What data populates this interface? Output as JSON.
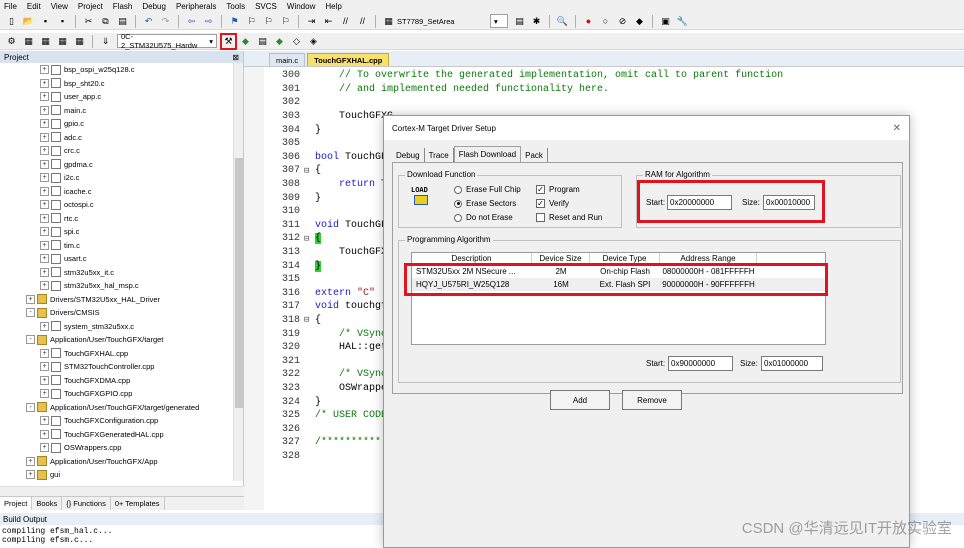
{
  "menubar": [
    "File",
    "Edit",
    "View",
    "Project",
    "Flash",
    "Debug",
    "Peripherals",
    "Tools",
    "SVCS",
    "Window",
    "Help"
  ],
  "toolbar": {
    "target_set_area": "ST7789_SetArea",
    "project_target": "0C-2_STM32U575_Hardw"
  },
  "project_panel": {
    "title": "Project",
    "items": [
      {
        "label": "bsp_ospi_w25q128.c",
        "type": "file",
        "indent": 3
      },
      {
        "label": "bsp_sht20.c",
        "type": "file",
        "indent": 3
      },
      {
        "label": "user_app.c",
        "type": "file",
        "indent": 3
      },
      {
        "label": "main.c",
        "type": "file",
        "indent": 3
      },
      {
        "label": "gpio.c",
        "type": "file",
        "indent": 3
      },
      {
        "label": "adc.c",
        "type": "file",
        "indent": 3
      },
      {
        "label": "crc.c",
        "type": "file",
        "indent": 3
      },
      {
        "label": "gpdma.c",
        "type": "file",
        "indent": 3
      },
      {
        "label": "i2c.c",
        "type": "file",
        "indent": 3
      },
      {
        "label": "icache.c",
        "type": "file",
        "indent": 3
      },
      {
        "label": "octospi.c",
        "type": "file",
        "indent": 3
      },
      {
        "label": "rtc.c",
        "type": "file",
        "indent": 3
      },
      {
        "label": "spi.c",
        "type": "file",
        "indent": 3
      },
      {
        "label": "tim.c",
        "type": "file",
        "indent": 3
      },
      {
        "label": "usart.c",
        "type": "file",
        "indent": 3
      },
      {
        "label": "stm32u5xx_it.c",
        "type": "file",
        "indent": 3
      },
      {
        "label": "stm32u5xx_hal_msp.c",
        "type": "file",
        "indent": 3
      },
      {
        "label": "Drivers/STM32U5xx_HAL_Driver",
        "type": "folder",
        "indent": 2,
        "sign": "+"
      },
      {
        "label": "Drivers/CMSIS",
        "type": "folder",
        "indent": 2,
        "sign": "-"
      },
      {
        "label": "system_stm32u5xx.c",
        "type": "file",
        "indent": 3
      },
      {
        "label": "Application/User/TouchGFX/target",
        "type": "folder",
        "indent": 2,
        "sign": "-"
      },
      {
        "label": "TouchGFXHAL.cpp",
        "type": "file",
        "indent": 3
      },
      {
        "label": "STM32TouchController.cpp",
        "type": "file",
        "indent": 3
      },
      {
        "label": "TouchGFXDMA.cpp",
        "type": "file",
        "indent": 3
      },
      {
        "label": "TouchGFXGPIO.cpp",
        "type": "file",
        "indent": 3
      },
      {
        "label": "Application/User/TouchGFX/target/generated",
        "type": "folder",
        "indent": 2,
        "sign": "-"
      },
      {
        "label": "TouchGFXConfiguration.cpp",
        "type": "file",
        "indent": 3
      },
      {
        "label": "TouchGFXGeneratedHAL.cpp",
        "type": "file",
        "indent": 3
      },
      {
        "label": "OSWrappers.cpp",
        "type": "file",
        "indent": 3
      },
      {
        "label": "Application/User/TouchGFX/App",
        "type": "folder",
        "indent": 2,
        "sign": "+"
      },
      {
        "label": "gui",
        "type": "folder",
        "indent": 2,
        "sign": "+"
      }
    ],
    "bottom_tabs": [
      "Project",
      "Books",
      "{} Functions",
      "0+ Templates"
    ]
  },
  "editor": {
    "tabs": [
      {
        "label": "main.c",
        "active": false
      },
      {
        "label": "TouchGFXHAL.cpp",
        "active": true
      }
    ],
    "lines": [
      {
        "n": "300",
        "fold": "",
        "segs": [
          {
            "t": "    // To overwrite the generated implementation, omit call to parent function",
            "c": "cm"
          }
        ]
      },
      {
        "n": "301",
        "fold": "",
        "segs": [
          {
            "t": "    // and implemented needed functionality here.",
            "c": "cm"
          }
        ]
      },
      {
        "n": "302",
        "fold": "",
        "segs": [
          {
            "t": "",
            "c": ""
          }
        ]
      },
      {
        "n": "303",
        "fold": "",
        "segs": [
          {
            "t": "    TouchGFXG",
            "c": ""
          }
        ]
      },
      {
        "n": "304",
        "fold": "",
        "segs": [
          {
            "t": "}",
            "c": ""
          }
        ]
      },
      {
        "n": "305",
        "fold": "",
        "segs": [
          {
            "t": "",
            "c": ""
          }
        ]
      },
      {
        "n": "306",
        "fold": "",
        "segs": [
          {
            "t": "bool",
            "c": "kw"
          },
          {
            "t": " TouchGFX",
            "c": ""
          }
        ]
      },
      {
        "n": "307",
        "fold": "⊟",
        "segs": [
          {
            "t": "{",
            "c": ""
          }
        ]
      },
      {
        "n": "308",
        "fold": "",
        "segs": [
          {
            "t": "    ",
            "c": ""
          },
          {
            "t": "return",
            "c": "kw"
          },
          {
            "t": " To",
            "c": ""
          }
        ]
      },
      {
        "n": "309",
        "fold": "",
        "segs": [
          {
            "t": "}",
            "c": ""
          }
        ]
      },
      {
        "n": "310",
        "fold": "",
        "segs": [
          {
            "t": "",
            "c": ""
          }
        ]
      },
      {
        "n": "311",
        "fold": "",
        "segs": [
          {
            "t": "void",
            "c": "kw"
          },
          {
            "t": " TouchGFX",
            "c": ""
          }
        ]
      },
      {
        "n": "312",
        "fold": "⊟",
        "segs": [
          {
            "t": "{",
            "c": "hl"
          }
        ]
      },
      {
        "n": "313",
        "fold": "",
        "segs": [
          {
            "t": "    TouchGFXG",
            "c": ""
          }
        ]
      },
      {
        "n": "314",
        "fold": "",
        "segs": [
          {
            "t": "}",
            "c": "hl"
          }
        ]
      },
      {
        "n": "315",
        "fold": "",
        "segs": [
          {
            "t": "",
            "c": ""
          }
        ]
      },
      {
        "n": "316",
        "fold": "",
        "segs": [
          {
            "t": "extern",
            "c": "kw"
          },
          {
            "t": " ",
            "c": ""
          },
          {
            "t": "\"C\"",
            "c": "st"
          }
        ]
      },
      {
        "n": "317",
        "fold": "",
        "segs": [
          {
            "t": "void",
            "c": "kw"
          },
          {
            "t": " touchgfx",
            "c": ""
          }
        ]
      },
      {
        "n": "318",
        "fold": "⊟",
        "segs": [
          {
            "t": "{",
            "c": ""
          }
        ]
      },
      {
        "n": "319",
        "fold": "",
        "segs": [
          {
            "t": "    /* VSync",
            "c": "cm"
          }
        ]
      },
      {
        "n": "320",
        "fold": "",
        "segs": [
          {
            "t": "    HAL::getI",
            "c": ""
          }
        ]
      },
      {
        "n": "321",
        "fold": "",
        "segs": [
          {
            "t": "",
            "c": ""
          }
        ]
      },
      {
        "n": "322",
        "fold": "",
        "segs": [
          {
            "t": "    /* VSync",
            "c": "cm"
          }
        ]
      },
      {
        "n": "323",
        "fold": "",
        "segs": [
          {
            "t": "    OSWrapper",
            "c": ""
          }
        ]
      },
      {
        "n": "324",
        "fold": "",
        "segs": [
          {
            "t": "}",
            "c": ""
          }
        ]
      },
      {
        "n": "325",
        "fold": "",
        "segs": [
          {
            "t": "/* USER CODE",
            "c": "cm"
          }
        ]
      },
      {
        "n": "326",
        "fold": "",
        "segs": [
          {
            "t": "",
            "c": ""
          }
        ]
      },
      {
        "n": "327",
        "fold": "",
        "segs": [
          {
            "t": "/**********",
            "c": "cm"
          }
        ]
      },
      {
        "n": "328",
        "fold": "",
        "segs": [
          {
            "t": "",
            "c": ""
          }
        ]
      }
    ]
  },
  "build_output": {
    "title": "Build Output",
    "lines": [
      "compiling efsm_hal.c...",
      "compiling efsm.c..."
    ]
  },
  "dialog": {
    "title": "Cortex-M Target Driver Setup",
    "tabs": [
      {
        "label": "Debug",
        "active": false
      },
      {
        "label": "Trace",
        "active": false
      },
      {
        "label": "Flash Download",
        "active": true
      },
      {
        "label": "Pack",
        "active": false
      }
    ],
    "download_function": {
      "label": "Download Function",
      "load_icon_text": "LOAD",
      "radios": [
        {
          "label": "Erase Full Chip",
          "checked": false
        },
        {
          "label": "Erase Sectors",
          "checked": true
        },
        {
          "label": "Do not Erase",
          "checked": false
        }
      ],
      "checks": [
        {
          "label": "Program",
          "checked": true
        },
        {
          "label": "Verify",
          "checked": true
        },
        {
          "label": "Reset and Run",
          "checked": false
        }
      ]
    },
    "ram": {
      "label": "RAM for Algorithm",
      "start_label": "Start:",
      "start": "0x20000000",
      "size_label": "Size:",
      "size": "0x00010000"
    },
    "programming": {
      "label": "Programming Algorithm",
      "columns": [
        "Description",
        "Device Size",
        "Device Type",
        "Address Range"
      ],
      "rows": [
        {
          "description": "STM32U5xx 2M NSecure ...",
          "size": "2M",
          "type": "On-chip Flash",
          "range": "08000000H - 081FFFFFH"
        },
        {
          "description": "HQYJ_U575RI_W25Q128",
          "size": "16M",
          "type": "Ext. Flash SPI",
          "range": "90000000H - 90FFFFFFH"
        }
      ],
      "start_label": "Start:",
      "start": "0x90000000",
      "size_label": "Size:",
      "size": "0x01000000"
    },
    "buttons": {
      "add": "Add",
      "remove": "Remove"
    }
  },
  "watermark": "CSDN @华清远见IT开放实验室"
}
